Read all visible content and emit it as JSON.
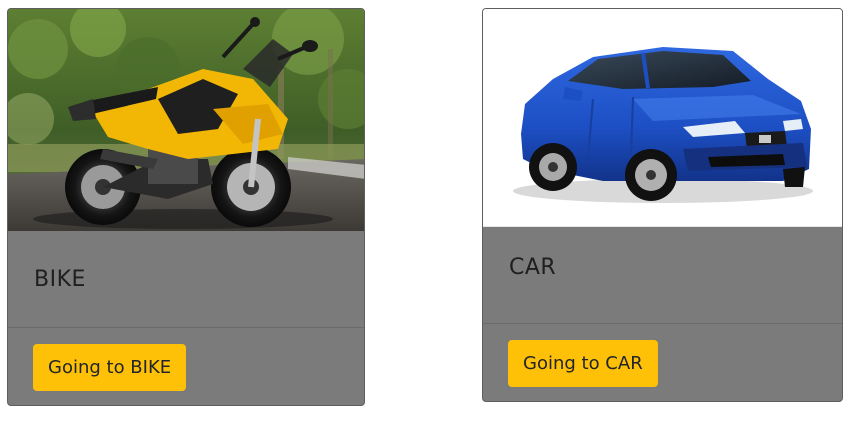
{
  "cards": [
    {
      "image_name": "motorcycle-photo",
      "title": "BIKE",
      "button_label": "Going to BIKE"
    },
    {
      "image_name": "car-photo",
      "title": "CAR",
      "button_label": "Going to CAR"
    }
  ],
  "colors": {
    "card_background": "#7b7b7b",
    "button_background": "#ffc107",
    "button_text": "#212529",
    "title_text": "#1f1f1f",
    "bike_yellow": "#f2b705",
    "car_blue": "#1d4fc4"
  }
}
